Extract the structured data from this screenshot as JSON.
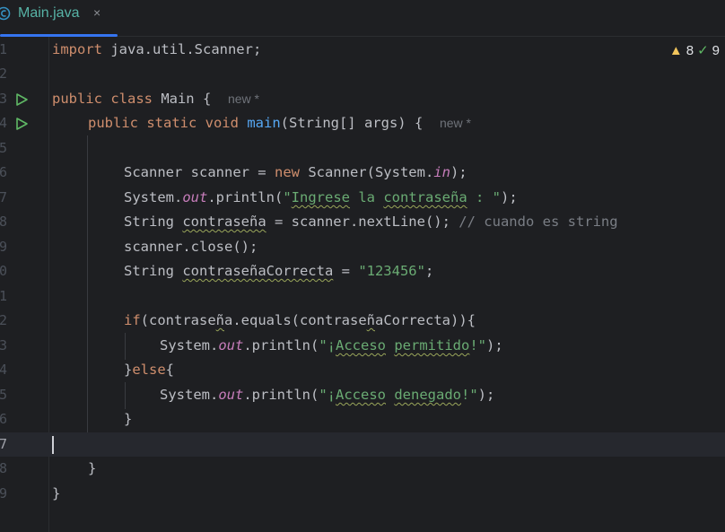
{
  "tab": {
    "label": "Main.java",
    "close": "×"
  },
  "inspections": {
    "warnings": "8",
    "ok_checks": "9",
    "warn_icon": "warning-triangle-icon",
    "ok_icon": "double-check-icon"
  },
  "line_numbers": [
    "1",
    "2",
    "3",
    "4",
    "5",
    "6",
    "7",
    "8",
    "9",
    "0",
    "1",
    "2",
    "3",
    "4",
    "5",
    "6",
    "7",
    "8",
    "9"
  ],
  "hints": {
    "class_hint": "new *",
    "method_hint": "new *"
  },
  "code": {
    "l1": [
      "import",
      " java.util.Scanner;"
    ],
    "l3": [
      "public class",
      " Main {  "
    ],
    "l4": [
      "public static void",
      " ",
      "main",
      "(String[] args) {  "
    ],
    "l6": [
      "Scanner scanner = ",
      "new",
      " Scanner(System.",
      "in",
      ");"
    ],
    "l7": [
      "System.",
      "out",
      ".println(",
      "\"",
      "Ingrese",
      " la ",
      "contraseña",
      " : \"",
      ");"
    ],
    "l8": [
      "String ",
      "contraseña",
      " = scanner.nextLine(); ",
      "// cuando es string"
    ],
    "l9": [
      "scanner.close();"
    ],
    "l10": [
      "String ",
      "contraseñaCorrecta",
      " = ",
      "\"123456\"",
      ";"
    ],
    "l12": [
      "if",
      "(contrase",
      "ñ",
      "a.equals(contrase",
      "ñ",
      "aCorrecta)){"
    ],
    "l13": [
      "System.",
      "out",
      ".println(",
      "\"¡",
      "Acceso",
      " ",
      "permitido",
      "!\"",
      ");"
    ],
    "l14": [
      "}",
      "else",
      "{"
    ],
    "l15": [
      "System.",
      "out",
      ".println(",
      "\"¡",
      "Acceso",
      " ",
      "denegado",
      "!\"",
      ");"
    ],
    "l16": [
      "}"
    ],
    "l18": [
      "}"
    ],
    "l19": [
      "}"
    ]
  }
}
